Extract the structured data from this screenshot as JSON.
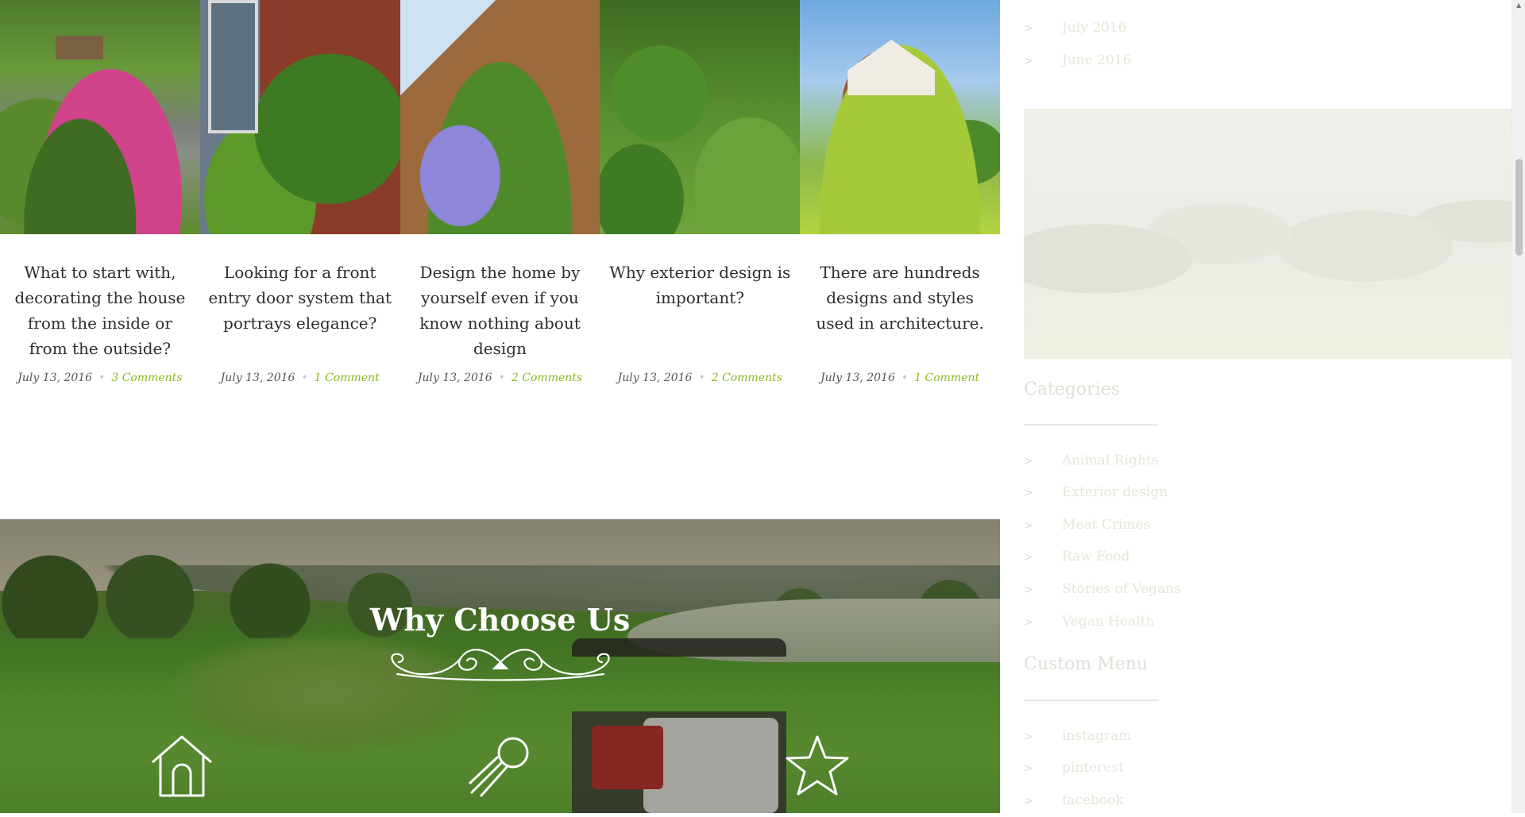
{
  "posts": [
    {
      "title": "What to start with, decorating the house from the inside or from the outside?",
      "date": "July 13, 2016",
      "comments": "3 Comments"
    },
    {
      "title": "Looking for a front entry door system that portrays elegance?",
      "date": "July 13, 2016",
      "comments": "1 Comment"
    },
    {
      "title": "Design the home by yourself even if you know nothing about design",
      "date": "July 13, 2016",
      "comments": "2 Comments"
    },
    {
      "title": "Why exterior design is important?",
      "date": "July 13, 2016",
      "comments": "2 Comments"
    },
    {
      "title": "There are hundreds designs and styles used in architecture.",
      "date": "July 13, 2016",
      "comments": "1 Comment"
    }
  ],
  "why": {
    "title": "Why Choose Us",
    "icons": [
      "home-icon",
      "rocket-icon",
      "star-icon"
    ]
  },
  "sidebar": {
    "archives": [
      "July 2016",
      "June 2016"
    ],
    "categories": {
      "title": "Categories",
      "items": [
        "Animal Rights",
        "Exterior design",
        "Meat Crimes",
        "Raw Food",
        "Stories of Vegans",
        "Vegan Health"
      ]
    },
    "custom_menu": {
      "title": "Custom Menu",
      "items": [
        "instagram",
        "pinterest",
        "facebook"
      ]
    }
  },
  "colors": {
    "accent": "#8ab91e",
    "text": "#2d2d2d",
    "faded": "#e4e8d9"
  }
}
